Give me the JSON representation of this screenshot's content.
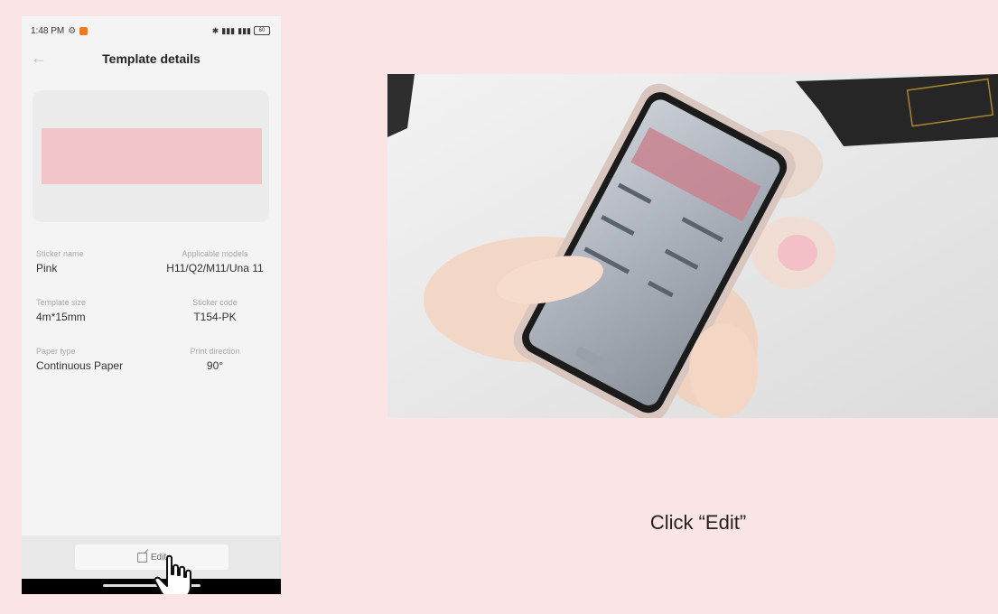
{
  "status_bar": {
    "time": "1:48 PM",
    "battery": "60"
  },
  "header": {
    "title": "Template details"
  },
  "details": [
    {
      "left_label": "Sticker name",
      "left_value": "Pink",
      "right_label": "Applicable models",
      "right_value": "H11/Q2/M11/Una 11"
    },
    {
      "left_label": "Template size",
      "left_value": "4m*15mm",
      "right_label": "Sticker code",
      "right_value": "T154-PK"
    },
    {
      "left_label": "Paper type",
      "left_value": "Continuous Paper",
      "right_label": "Print direction",
      "right_value": "90°"
    }
  ],
  "footer": {
    "edit_label": "Edit"
  },
  "instruction": {
    "caption": "Click “Edit”"
  },
  "icons": {
    "back": "arrow-left-icon",
    "edit": "edit-square-icon",
    "cursor": "hand-pointer-icon"
  },
  "colors": {
    "page_background": "#fbe4e6",
    "sticker_pink": "#f2c5c9",
    "app_badge": "#f07a1e"
  }
}
